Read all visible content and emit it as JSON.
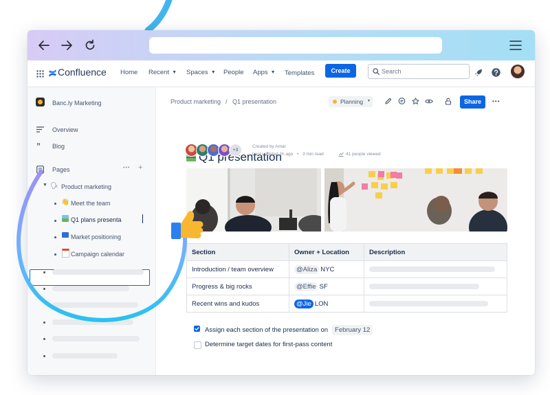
{
  "browser": {
    "back_icon": "arrow-left-icon",
    "forward_icon": "arrow-right-icon",
    "reload_icon": "reload-icon",
    "menu_icon": "hamburger-icon",
    "url": ""
  },
  "nav": {
    "product": "Confluence",
    "items": [
      {
        "label": "Home"
      },
      {
        "label": "Recent"
      },
      {
        "label": "Spaces"
      },
      {
        "label": "People"
      },
      {
        "label": "Apps"
      },
      {
        "label": "Templates"
      }
    ],
    "create": "Create",
    "search_placeholder": "Search"
  },
  "sidebar": {
    "space": "Banc.ly Marketing",
    "overview": "Overview",
    "blog": "Blog",
    "pages": "Pages",
    "more": "•••",
    "add": "+",
    "tree": [
      {
        "label": "Product marketing"
      },
      {
        "label": "Meet the team"
      },
      {
        "label": "Q1 plans presenta"
      },
      {
        "label": "Market positioning"
      },
      {
        "label": "Campaign calendar"
      }
    ]
  },
  "page": {
    "breadcrumb": [
      "Product marketing",
      "Q1 presentation"
    ],
    "crumb_sep": "/",
    "status": "Planning",
    "share": "Share",
    "more": "•••",
    "title": "Q1 presentation",
    "contributors_more": "+3",
    "created_by": "Created by Amar",
    "last_updated": "Last updated 1h ago",
    "read_time": "3 min read",
    "viewed": "41 people viewed",
    "accent": "#0c66e4"
  },
  "table": {
    "headers": [
      "Section",
      "Owner + Location",
      "Description"
    ],
    "rows": [
      {
        "section": "Introduction / team overview",
        "owner": "@Aliza",
        "location": "NYC"
      },
      {
        "section": "Progress & big rocks",
        "owner": "@Effie",
        "location": "SF"
      },
      {
        "section": "Recent wins and kudos",
        "owner": "@Jie",
        "location": "LON"
      }
    ]
  },
  "tasks": [
    {
      "label": "Assign each section of the presentation on",
      "date": "February 12",
      "checked": true
    },
    {
      "label": "Determine target dates for first-pass content",
      "checked": false
    }
  ]
}
